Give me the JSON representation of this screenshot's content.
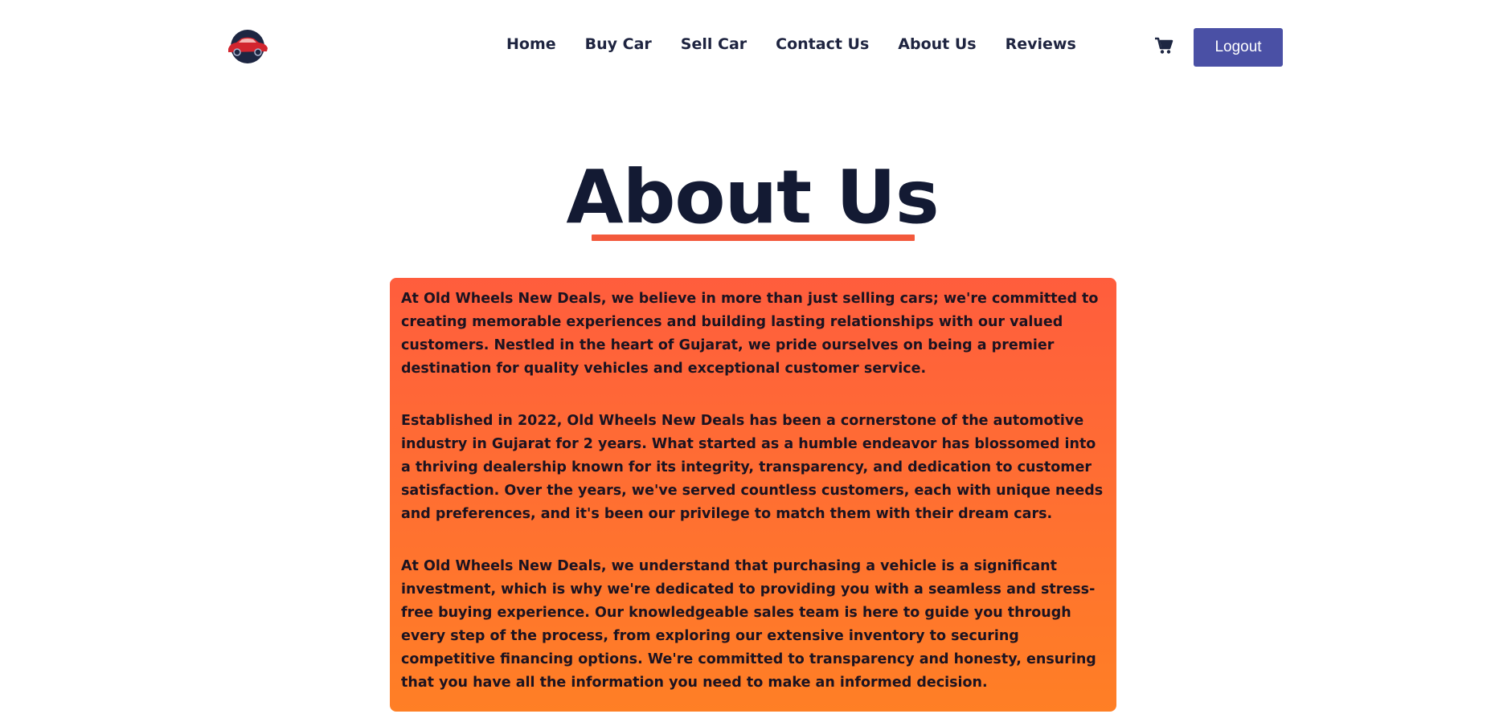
{
  "nav": {
    "logo_icon": "red-car-logo-icon",
    "links": [
      {
        "label": "Home"
      },
      {
        "label": "Buy Car"
      },
      {
        "label": "Sell Car"
      },
      {
        "label": "Contact Us"
      },
      {
        "label": "About Us"
      },
      {
        "label": "Reviews"
      }
    ],
    "cart_icon": "shopping-cart-icon",
    "logout_label": "Logout"
  },
  "main": {
    "title": "About Us",
    "paragraphs": [
      "At Old Wheels New Deals, we believe in more than just selling cars; we're committed to creating memorable experiences and building lasting relationships with our valued customers. Nestled in the heart of Gujarat, we pride ourselves on being a premier destination for quality vehicles and exceptional customer service.",
      "Established in 2022, Old Wheels New Deals has been a cornerstone of the automotive industry in Gujarat for 2 years. What started as a humble endeavor has blossomed into a thriving dealership known for its integrity, transparency, and dedication to customer satisfaction. Over the years, we've served countless customers, each with unique needs and preferences, and it's been our privilege to match them with their dream cars.",
      "At Old Wheels New Deals, we understand that purchasing a vehicle is a significant investment, which is why we're dedicated to providing you with a seamless and stress-free buying experience. Our knowledgeable sales team is here to guide you through every step of the process, from exploring our extensive inventory to securing competitive financing options. We're committed to transparency and honesty, ensuring that you have all the information you need to make an informed decision."
    ]
  },
  "colors": {
    "accent": "#4a50a5",
    "underline": "#f3593c",
    "card_gradient_top": "#ff5d3d",
    "card_gradient_bottom": "#ff7f25",
    "text_dark": "#131a33"
  }
}
